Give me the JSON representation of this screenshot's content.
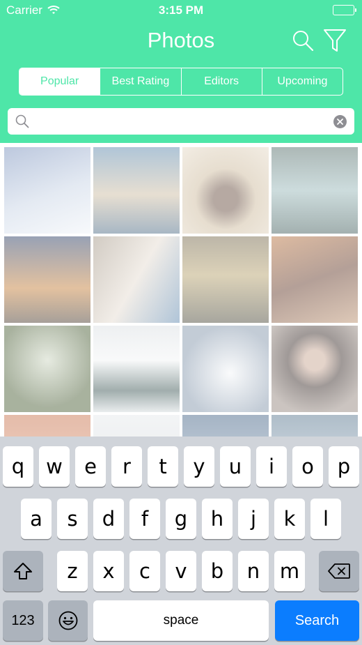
{
  "status_bar": {
    "carrier": "Carrier",
    "time": "3:15 PM"
  },
  "nav": {
    "title": "Photos"
  },
  "tabs": [
    {
      "label": "Popular",
      "active": true
    },
    {
      "label": "Best Rating",
      "active": false
    },
    {
      "label": "Editors",
      "active": false
    },
    {
      "label": "Upcoming",
      "active": false
    }
  ],
  "search": {
    "value": "",
    "placeholder": ""
  },
  "photos": [
    "winter-night-snow",
    "balloon-pier-sunset",
    "puppy-with-ball",
    "lake-mountains-person",
    "canal-city-dusk",
    "woman-in-room",
    "cloudy-sky-landscape",
    "two-women-portrait",
    "forest-looking-up",
    "woman-snow-scarf",
    "clouds-aerial",
    "woman-dark-hair-portrait",
    "sunset-horizon",
    "snowy-trees",
    "sky-clouds",
    "mountain-lake"
  ],
  "keyboard": {
    "row1": [
      "q",
      "w",
      "e",
      "r",
      "t",
      "y",
      "u",
      "i",
      "o",
      "p"
    ],
    "row2": [
      "a",
      "s",
      "d",
      "f",
      "g",
      "h",
      "j",
      "k",
      "l"
    ],
    "row3": [
      "z",
      "x",
      "c",
      "v",
      "b",
      "n",
      "m"
    ],
    "numbers_label": "123",
    "space_label": "space",
    "return_label": "Search"
  },
  "colors": {
    "header": "#4ee6a8",
    "search_key": "#0b7dfe",
    "keyboard_bg": "#d0d4da"
  }
}
